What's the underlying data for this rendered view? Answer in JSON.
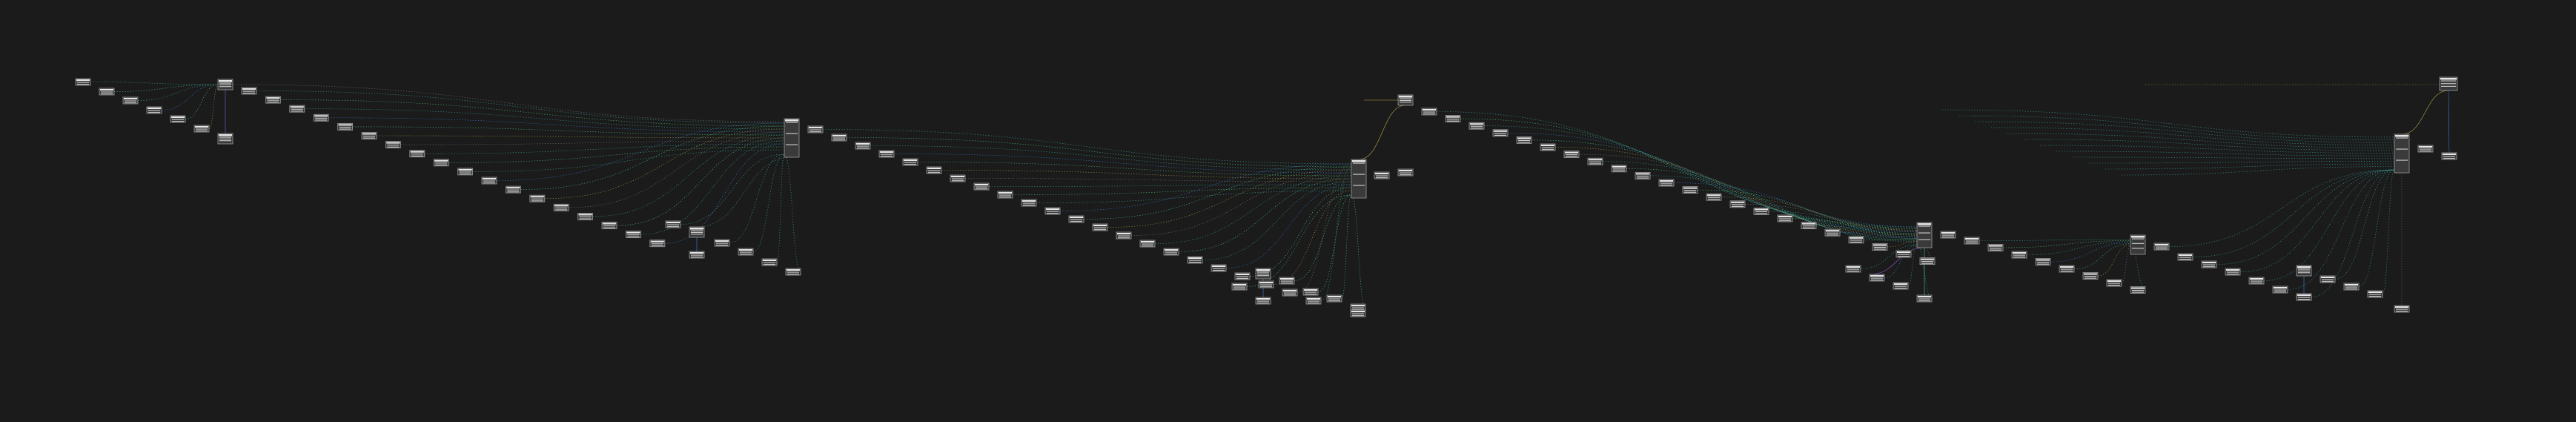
{
  "graph": {
    "background": "#1b1b1b",
    "edge_colors": {
      "green": "#4fd08a",
      "teal": "#3aa9a4",
      "blue": "#3b84e0",
      "olive": "#b6a548",
      "purple": "#8e5bd6",
      "gray": "#7a7a7a"
    },
    "node_count": 110,
    "clusters": [
      {
        "id": "c1",
        "root": "hub-1",
        "chain_nodes": 32
      },
      {
        "id": "c2",
        "root": "hub-2",
        "chain_nodes": 24
      },
      {
        "id": "c3",
        "root": "hub-3",
        "chain_nodes": 26
      },
      {
        "id": "c4",
        "root": "hub-4",
        "chain_nodes": 22
      }
    ]
  }
}
